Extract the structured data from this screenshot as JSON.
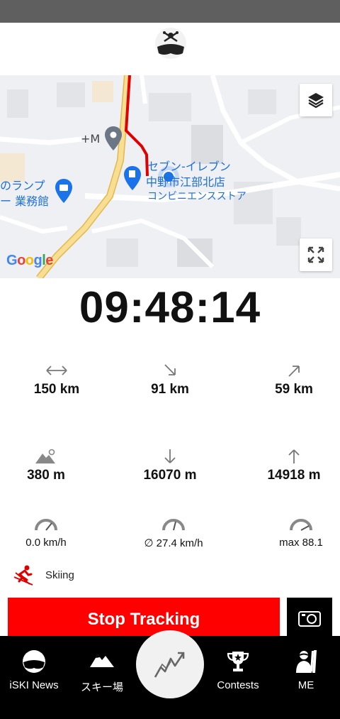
{
  "map": {
    "poi_marker": "+M",
    "store_name_1": "セブン-イレブン",
    "store_name_2": "中野市江部北店",
    "store_type": "コンビニエンスストア",
    "left_label_1": "のランプ",
    "left_label_2": "ー 業務館",
    "google_logo": "Google"
  },
  "timer": "09:48:14",
  "stats": {
    "distance": "150 km",
    "downhill_distance": "91 km",
    "uphill_distance": "59 km",
    "altitude": "380 m",
    "descent": "16070 m",
    "ascent": "14918 m",
    "speed": "0.0 km/h",
    "avg_speed": "∅ 27.4 km/h",
    "max_speed": "max 88.1"
  },
  "sport": {
    "label": "Skiing"
  },
  "actions": {
    "stop_label": "Stop Tracking"
  },
  "nav": [
    {
      "label": "iSKI  News"
    },
    {
      "label": "スキー場"
    },
    {
      "label": ""
    },
    {
      "label": "Contests"
    },
    {
      "label": "ME"
    }
  ],
  "colors": {
    "accent": "#ff0000",
    "nav_bg": "#000000",
    "map_bg": "#eef0f3",
    "road": "#f3d27a",
    "route": "#e00000"
  },
  "icons": {
    "logo": "iski-skull-logo-icon",
    "layers": "layers-icon",
    "fullscreen": "fullscreen-icon",
    "camera": "camera-icon",
    "news": "helmet-icon",
    "resorts": "mountain-icon",
    "tracking": "tracking-zigzag-icon",
    "contests": "trophy-icon",
    "me": "skier-icon"
  }
}
